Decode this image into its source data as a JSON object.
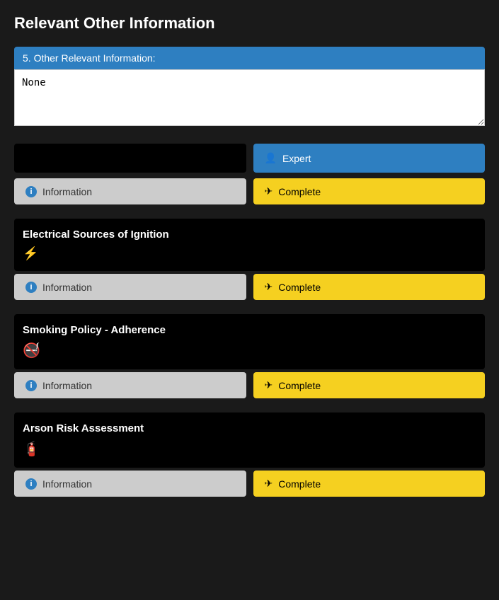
{
  "page": {
    "title": "Relevant Other Information"
  },
  "section5": {
    "label": "5. Other Relevant Information:",
    "textarea_value": "None",
    "textarea_placeholder": ""
  },
  "expert_button": {
    "label": "Expert",
    "icon": "user-icon"
  },
  "rows": [
    {
      "id": "row1",
      "dark_button_label": "",
      "information_label": "Information",
      "complete_label": "Complete"
    },
    {
      "id": "row2",
      "information_label": "Information",
      "complete_label": "Complete"
    },
    {
      "id": "row3",
      "information_label": "Information",
      "complete_label": "Complete"
    },
    {
      "id": "row4",
      "information_label": "Information",
      "complete_label": "Complete"
    }
  ],
  "sections": [
    {
      "id": "electrical",
      "title": "Electrical Sources of Ignition",
      "icon": "lightning-icon",
      "icon_char": "⚡"
    },
    {
      "id": "smoking",
      "title": "Smoking Policy - Adherence",
      "icon": "no-smoking-icon",
      "icon_char": "🚭"
    },
    {
      "id": "arson",
      "title": "Arson Risk Assessment",
      "icon": "arson-icon",
      "icon_char": "🧯"
    }
  ]
}
